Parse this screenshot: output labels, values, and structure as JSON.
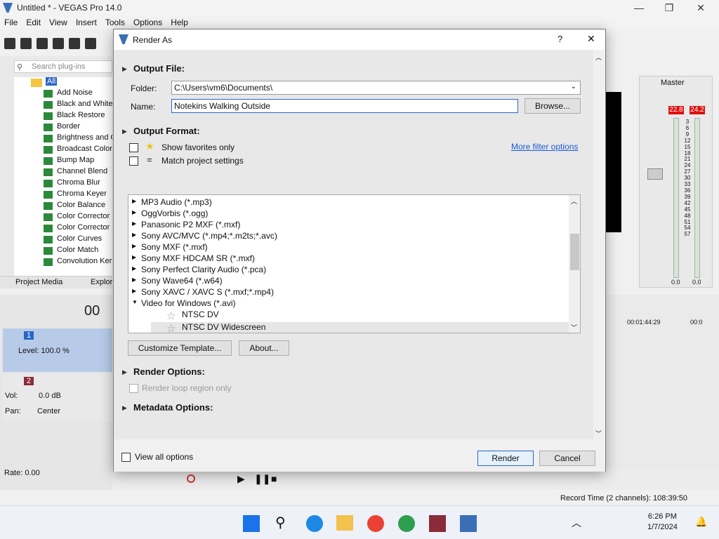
{
  "window": {
    "title": "Untitled * - VEGAS Pro 14.0"
  },
  "menu": [
    "File",
    "Edit",
    "View",
    "Insert",
    "Tools",
    "Options",
    "Help"
  ],
  "plugins": {
    "search_placeholder": "Search plug-ins",
    "root": "All",
    "items": [
      "Add Noise",
      "Black and White",
      "Black Restore",
      "Border",
      "Brightness and C",
      "Broadcast Colors",
      "Bump Map",
      "Channel Blend",
      "Chroma Blur",
      "Chroma Keyer",
      "Color Balance",
      "Color Corrector",
      "Color Corrector",
      "Color Curves",
      "Color Match",
      "Convolution Kern"
    ]
  },
  "left_tabs": [
    "Project Media",
    "Explor"
  ],
  "timecode": "00",
  "tracks": {
    "t1": {
      "number": "1",
      "level": "Level: 100.0 %"
    },
    "t2": {
      "number": "2",
      "vol_label": "Vol:",
      "vol": "0.0 dB",
      "pan_label": "Pan:",
      "pan": "Center"
    }
  },
  "rate": "Rate: 0.00",
  "mixer": {
    "label": "Master",
    "peak_l": "22.8",
    "peak_r": "24.2",
    "scale": [
      "3",
      "6",
      "9",
      "12",
      "15",
      "18",
      "21",
      "24",
      "27",
      "30",
      "33",
      "36",
      "39",
      "42",
      "45",
      "48",
      "51",
      "54",
      "57"
    ],
    "bottom_l": "0.0",
    "bottom_r": "0.0"
  },
  "ruler": {
    "time1": "00:01:44:29",
    "time2": "00:0"
  },
  "status": {
    "record_time": "Record Time (2 channels): 108:39:50"
  },
  "clock": {
    "time": "6:26 PM",
    "date": "1/7/2024"
  },
  "dialog": {
    "title": "Render As",
    "help": "?",
    "close": "✕",
    "output_file": {
      "header": "Output File:",
      "folder_label": "Folder:",
      "folder_value": "C:\\Users\\vm6\\Documents\\",
      "name_label": "Name:",
      "name_value": "Notekins Walking Outside",
      "browse": "Browse..."
    },
    "output_format": {
      "header": "Output Format:",
      "favorites": "Show favorites only",
      "match": "Match project settings",
      "more_filter": "More filter options",
      "formats": [
        "MP3 Audio (*.mp3)",
        "OggVorbis (*.ogg)",
        "Panasonic P2 MXF (*.mxf)",
        "Sony AVC/MVC (*.mp4;*.m2ts;*.avc)",
        "Sony MXF (*.mxf)",
        "Sony MXF HDCAM SR (*.mxf)",
        "Sony Perfect Clarity Audio (*.pca)",
        "Sony Wave64 (*.w64)",
        "Sony XAVC / XAVC S (*.mxf;*.mp4)",
        "Video for Windows (*.avi)"
      ],
      "templates": [
        "NTSC DV",
        "NTSC DV Widescreen"
      ],
      "customize": "Customize Template...",
      "about": "About..."
    },
    "render_options": {
      "header": "Render Options:",
      "loop": "Render loop region only"
    },
    "metadata": {
      "header": "Metadata Options:"
    },
    "view_all": "View all options",
    "render": "Render",
    "cancel": "Cancel"
  },
  "colors": {
    "accent": "#2b66c8",
    "peak": "#d11111",
    "track1": "#b7cbe8",
    "link": "#1a5bd6"
  }
}
